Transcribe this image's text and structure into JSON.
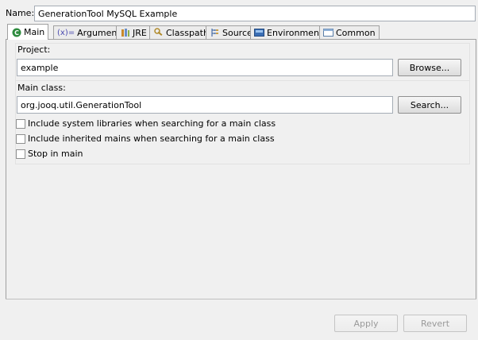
{
  "name_label": "Name:",
  "name_value": "GenerationTool MySQL Example",
  "tabs": [
    {
      "label": "Main",
      "icon": "main-class-icon"
    },
    {
      "label": "Arguments",
      "icon": "arguments-icon",
      "prefix": "(x)="
    },
    {
      "label": "JRE",
      "icon": "jre-library-icon"
    },
    {
      "label": "Classpath",
      "icon": "classpath-icon"
    },
    {
      "label": "Source",
      "icon": "source-icon"
    },
    {
      "label": "Environment",
      "icon": "environment-icon"
    },
    {
      "label": "Common",
      "icon": "common-icon"
    }
  ],
  "project": {
    "label": "Project:",
    "value": "example",
    "browse_label": "Browse..."
  },
  "main_class": {
    "label": "Main class:",
    "value": "org.jooq.util.GenerationTool",
    "search_label": "Search..."
  },
  "options": [
    {
      "label": "Include system libraries when searching for a main class",
      "checked": false
    },
    {
      "label": "Include inherited mains when searching for a main class",
      "checked": false
    },
    {
      "label": "Stop in main",
      "checked": false
    }
  ],
  "footer": {
    "apply_label": "Apply",
    "revert_label": "Revert"
  },
  "colors": {
    "background": "#f0f0f0",
    "main_icon_green": "#2e8b3e",
    "border": "#a0a0a0"
  }
}
